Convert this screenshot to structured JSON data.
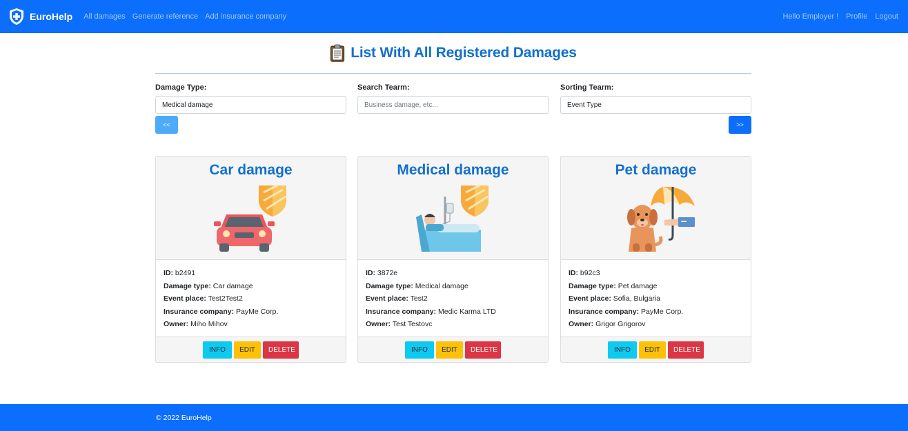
{
  "nav": {
    "brand": "EuroHelp",
    "links": [
      "All damages",
      "Generate reference",
      "Add insurance company"
    ],
    "greeting": "Hello Employer !",
    "profile": "Profile",
    "logout": "Logout"
  },
  "header": {
    "title": "List With All Registered Damages",
    "icon": "clipboard-icon"
  },
  "filters": {
    "damage_type": {
      "label": "Damage Type:",
      "value": "Medical damage"
    },
    "search": {
      "label": "Search Tearm:",
      "placeholder": "Business damage, etc..."
    },
    "sorting": {
      "label": "Sorting Tearm:",
      "value": "Event Type"
    },
    "prev_label": "<<",
    "next_label": ">>"
  },
  "labels": {
    "id": "ID:",
    "damage_type": "Damage type:",
    "event_place": "Event place:",
    "insurance_company": "Insurance company:",
    "owner": "Owner:",
    "info": "INFO",
    "edit": "EDIT",
    "delete": "DELETE"
  },
  "cards": [
    {
      "title": "Car damage",
      "id": "b2491",
      "damage_type": "Car damage",
      "event_place": "Test2Test2",
      "insurance_company": "PayMe Corp.",
      "owner": "Miho Mihov",
      "icon": "car-shield-icon"
    },
    {
      "title": "Medical damage",
      "id": "3872e",
      "damage_type": "Medical damage",
      "event_place": "Test2",
      "insurance_company": "Medic Karma LTD",
      "owner": "Test Testovc",
      "icon": "hospital-bed-shield-icon"
    },
    {
      "title": "Pet damage",
      "id": "b92c3",
      "damage_type": "Pet damage",
      "event_place": "Sofia, Bulgaria",
      "insurance_company": "PayMe Corp.",
      "owner": "Grigor Grigorov",
      "icon": "dog-umbrella-icon"
    }
  ],
  "footer": {
    "text": "© 2022 EuroHelp"
  },
  "colors": {
    "primary": "#0b6efd",
    "title": "#1270cf",
    "info": "#0fcaf0",
    "edit": "#ffc107",
    "delete": "#dc3545"
  }
}
